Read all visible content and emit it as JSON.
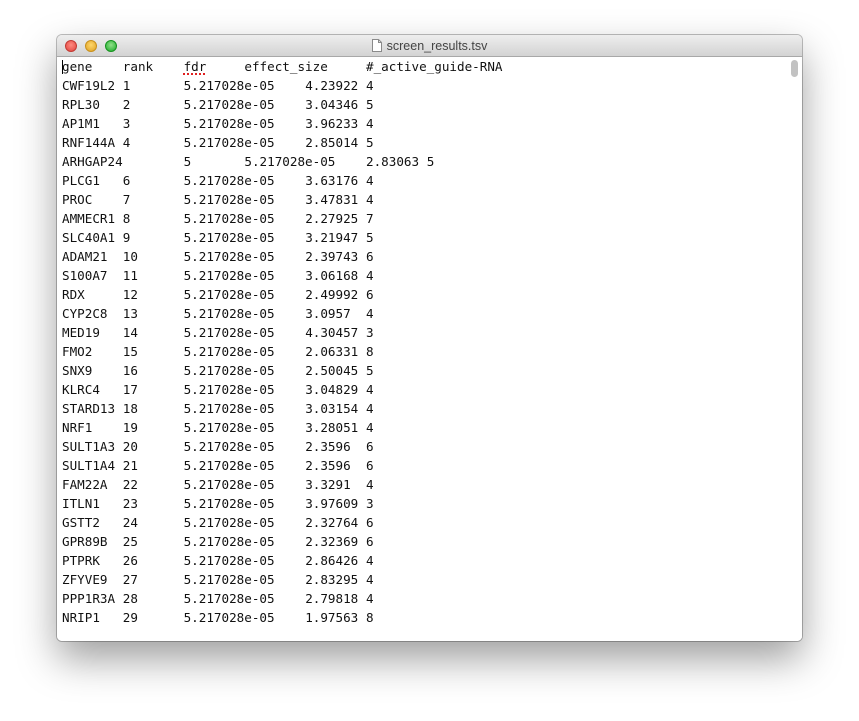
{
  "window": {
    "title": "screen_results.tsv",
    "icon": "document-icon"
  },
  "headers": [
    "gene",
    "rank",
    "fdr",
    "effect_size",
    "#_active_guide-RNA"
  ],
  "rows": [
    [
      "CWF19L2",
      "1",
      "5.217028e-05",
      "4.23922",
      "4"
    ],
    [
      "RPL30",
      "2",
      "5.217028e-05",
      "3.04346",
      "5"
    ],
    [
      "AP1M1",
      "3",
      "5.217028e-05",
      "3.96233",
      "4"
    ],
    [
      "RNF144A",
      "4",
      "5.217028e-05",
      "2.85014",
      "5"
    ],
    [
      "ARHGAP24",
      "5",
      "5.217028e-05",
      "2.83063",
      "5"
    ],
    [
      "PLCG1",
      "6",
      "5.217028e-05",
      "3.63176",
      "4"
    ],
    [
      "PROC",
      "7",
      "5.217028e-05",
      "3.47831",
      "4"
    ],
    [
      "AMMECR1",
      "8",
      "5.217028e-05",
      "2.27925",
      "7"
    ],
    [
      "SLC40A1",
      "9",
      "5.217028e-05",
      "3.21947",
      "5"
    ],
    [
      "ADAM21",
      "10",
      "5.217028e-05",
      "2.39743",
      "6"
    ],
    [
      "S100A7",
      "11",
      "5.217028e-05",
      "3.06168",
      "4"
    ],
    [
      "RDX",
      "12",
      "5.217028e-05",
      "2.49992",
      "6"
    ],
    [
      "CYP2C8",
      "13",
      "5.217028e-05",
      "3.0957",
      "4"
    ],
    [
      "MED19",
      "14",
      "5.217028e-05",
      "4.30457",
      "3"
    ],
    [
      "FMO2",
      "15",
      "5.217028e-05",
      "2.06331",
      "8"
    ],
    [
      "SNX9",
      "16",
      "5.217028e-05",
      "2.50045",
      "5"
    ],
    [
      "KLRC4",
      "17",
      "5.217028e-05",
      "3.04829",
      "4"
    ],
    [
      "STARD13",
      "18",
      "5.217028e-05",
      "3.03154",
      "4"
    ],
    [
      "NRF1",
      "19",
      "5.217028e-05",
      "3.28051",
      "4"
    ],
    [
      "SULT1A3",
      "20",
      "5.217028e-05",
      "2.3596",
      "6"
    ],
    [
      "SULT1A4",
      "21",
      "5.217028e-05",
      "2.3596",
      "6"
    ],
    [
      "FAM22A",
      "22",
      "5.217028e-05",
      "3.3291",
      "4"
    ],
    [
      "ITLN1",
      "23",
      "5.217028e-05",
      "3.97609",
      "3"
    ],
    [
      "GSTT2",
      "24",
      "5.217028e-05",
      "2.32764",
      "6"
    ],
    [
      "GPR89B",
      "25",
      "5.217028e-05",
      "2.32369",
      "6"
    ],
    [
      "PTPRK",
      "26",
      "5.217028e-05",
      "2.86426",
      "4"
    ],
    [
      "ZFYVE9",
      "27",
      "5.217028e-05",
      "2.83295",
      "4"
    ],
    [
      "PPP1R3A",
      "28",
      "5.217028e-05",
      "2.79818",
      "4"
    ],
    [
      "NRIP1",
      "29",
      "5.217028e-05",
      "1.97563",
      "8"
    ]
  ]
}
